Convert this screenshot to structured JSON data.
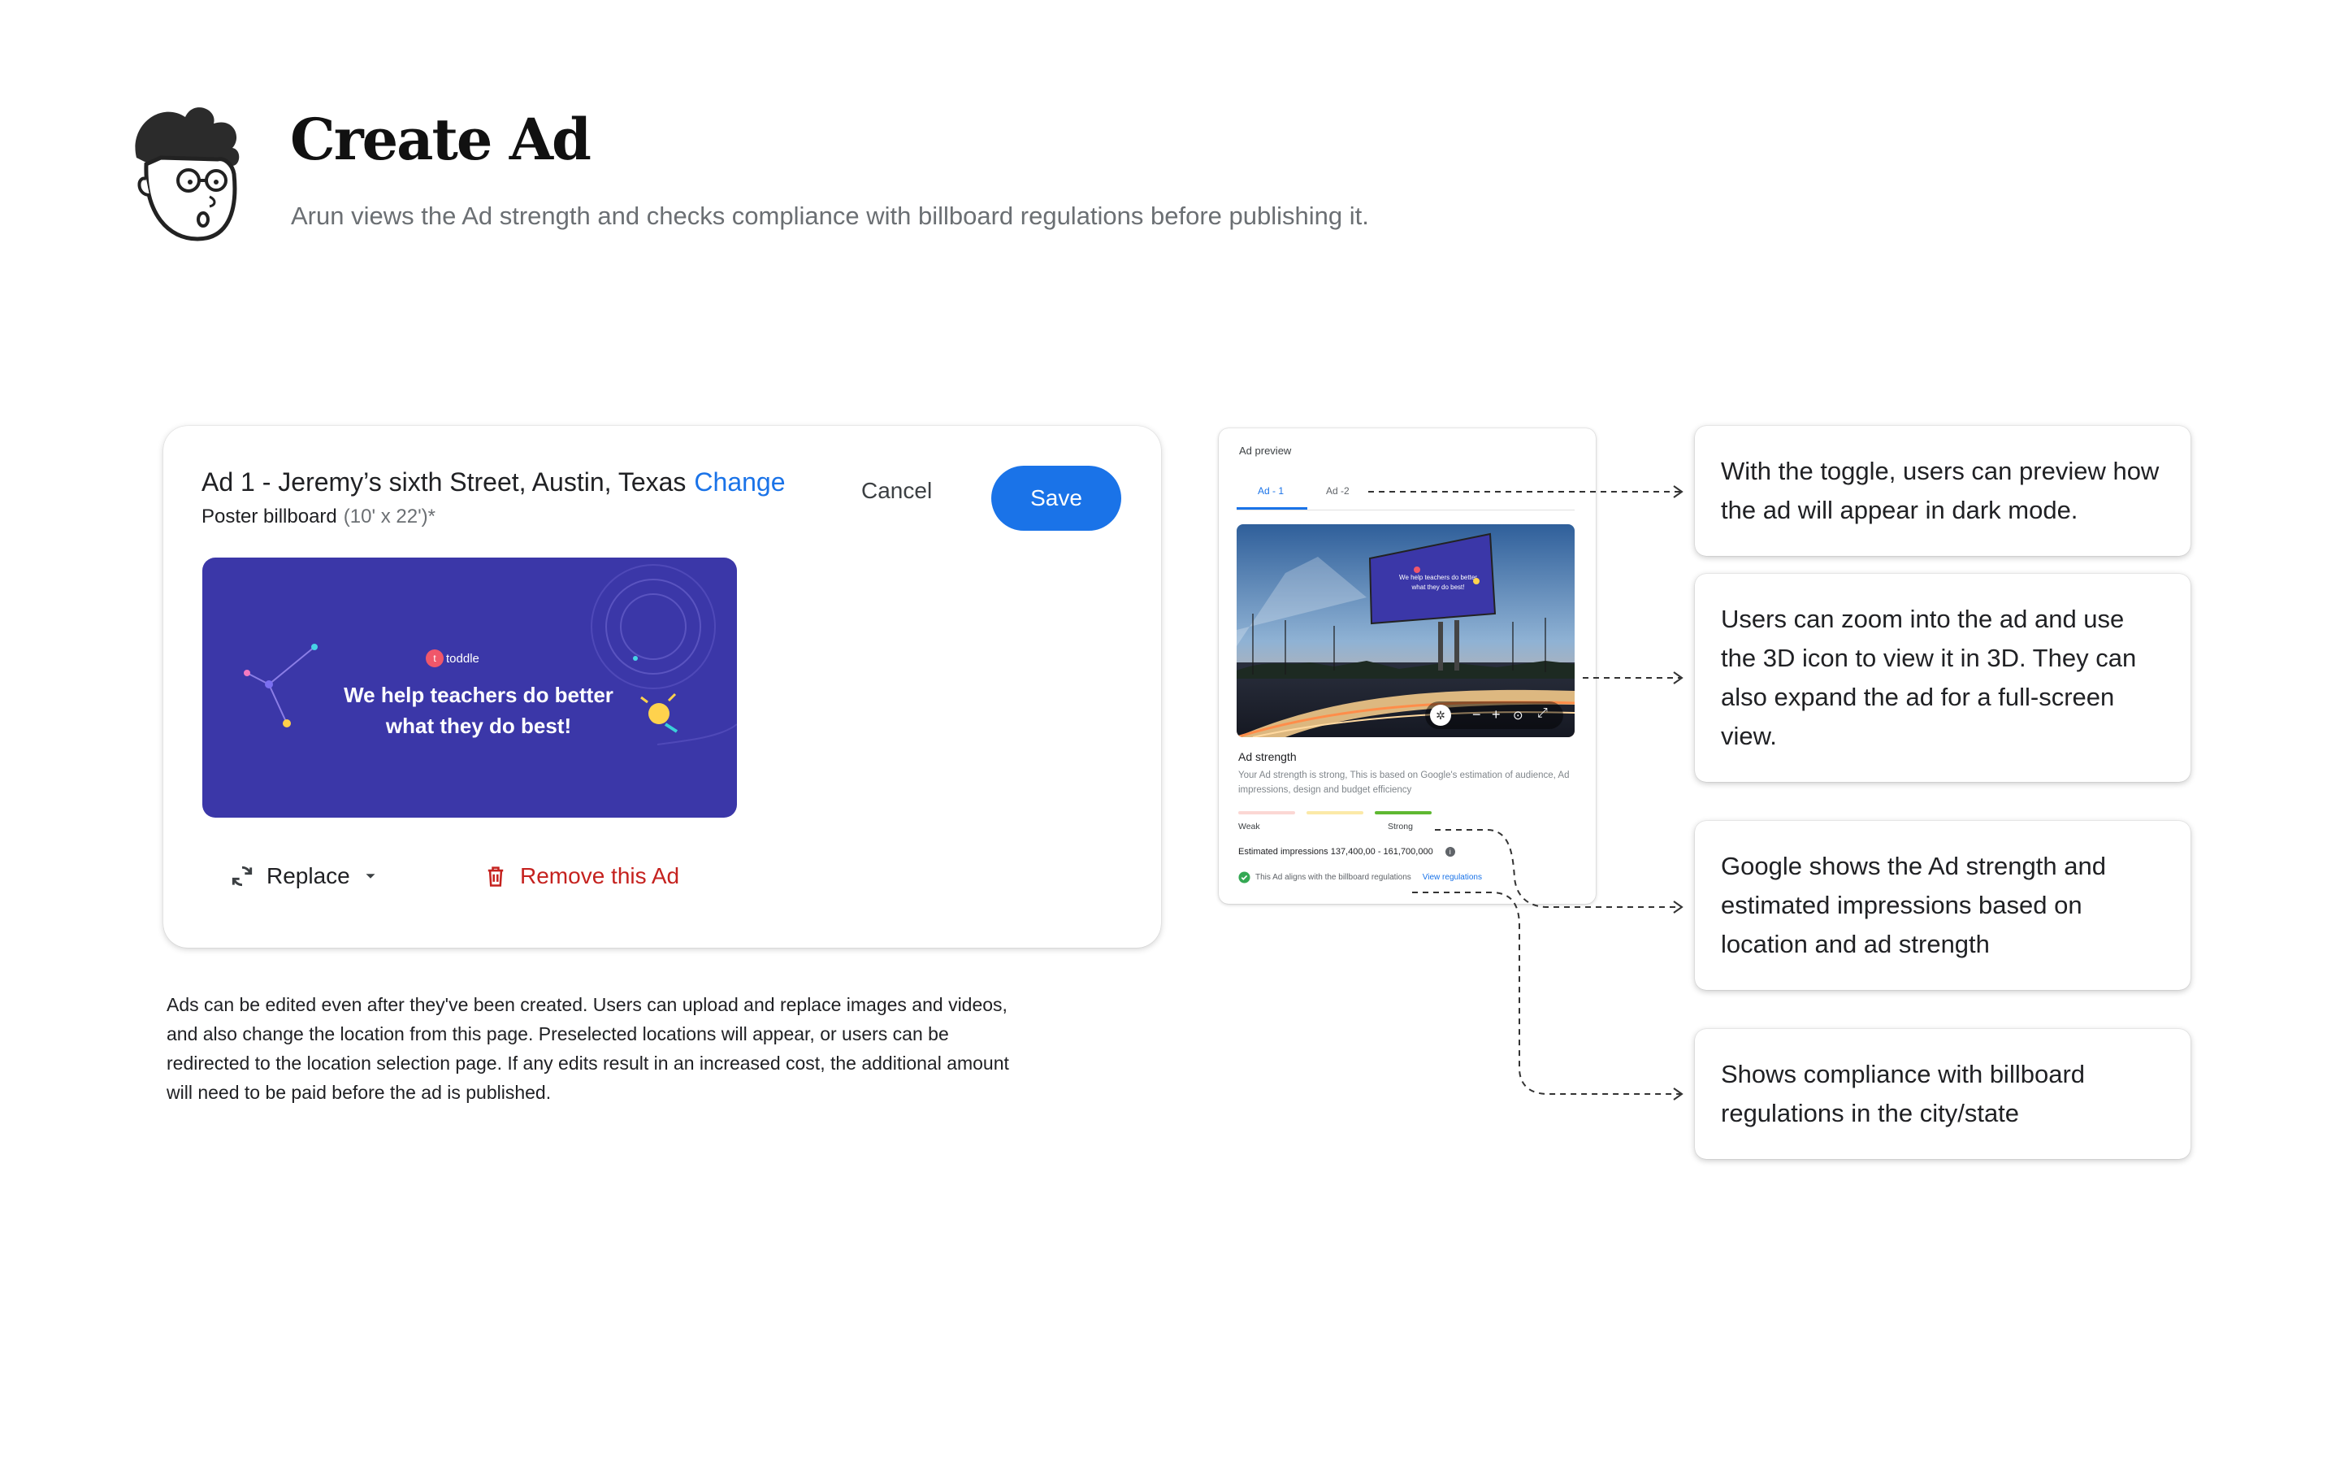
{
  "header": {
    "title": "Create Ad",
    "subtitle": "Arun views the Ad strength and checks compliance with billboard regulations before publishing it."
  },
  "edit_card": {
    "ad_name": "Ad 1 - Jeremy’s sixth Street, Austin, Texas",
    "change_link": "Change",
    "format": "Poster billboard",
    "dimensions": "(10' x 22')*",
    "cancel_label": "Cancel",
    "save_label": "Save",
    "banner": {
      "brand": "toddle",
      "headline_line1": "We help teachers do better",
      "headline_line2": "what they do best!"
    },
    "replace_label": "Replace",
    "remove_label": "Remove this Ad"
  },
  "description": "Ads can be edited even after they've been created. Users can upload and replace images and videos, and also change the location from this page. Preselected locations will appear, or users can be redirected to the location selection page. If any edits result in an increased cost, the additional amount will need to be paid before the ad is published.",
  "preview": {
    "label": "Ad preview",
    "tabs": [
      "Ad - 1",
      "Ad -2"
    ],
    "active_tab": 0,
    "strength_heading": "Ad strength",
    "strength_text": "Your Ad strength is strong, This is based on Google's estimation of audience, Ad impressions, design and budget efficiency",
    "strength_low": "Weak",
    "strength_high": "Strong",
    "strength_level": 0.6,
    "impressions": "Estimated impressions 137,400,00 - 161,700,000",
    "compliance_text": "This Ad aligns with the billboard regulations",
    "compliance_link": "View regulations",
    "colors": {
      "strong": "#5fb832",
      "medium": "#fbe9a8",
      "weak": "#fbd7d4",
      "accent": "#1a73e8"
    }
  },
  "callouts": [
    "With the toggle, users can preview how the ad will appear in dark mode.",
    "Users can zoom into the ad and use the 3D icon to view it in 3D. They can also expand the ad for a full-screen view.",
    "Google shows the Ad strength and estimated impressions based on location and ad strength",
    "Shows compliance with billboard regulations in the city/state"
  ],
  "icons": [
    "avatar-sketch",
    "refresh-icon",
    "chevron-down-icon",
    "trash-icon",
    "check-circle-icon",
    "info-icon",
    "3d-icon",
    "zoom-out-icon",
    "zoom-in-icon",
    "fullscreen-icon"
  ]
}
